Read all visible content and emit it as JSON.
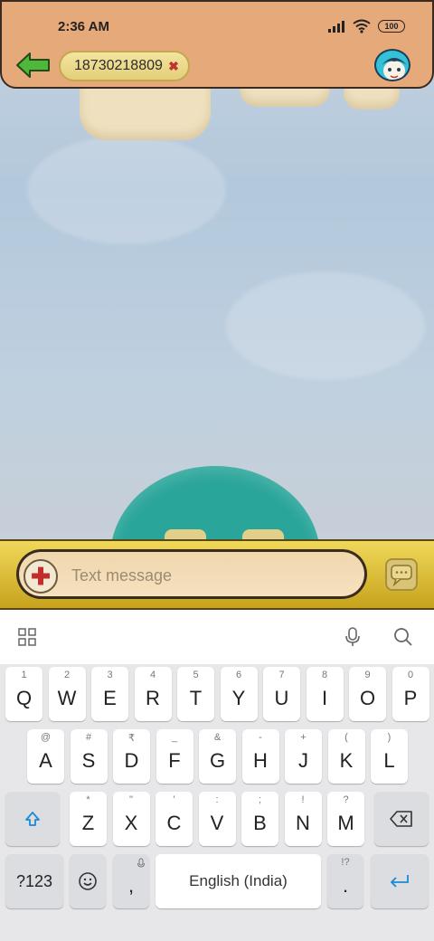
{
  "status_bar": {
    "time": "2:36 AM",
    "battery": "100"
  },
  "header": {
    "recipient": "18730218809"
  },
  "compose": {
    "placeholder": "Text message"
  },
  "keyboard": {
    "row1": [
      {
        "hint": "1",
        "label": "Q"
      },
      {
        "hint": "2",
        "label": "W"
      },
      {
        "hint": "3",
        "label": "E"
      },
      {
        "hint": "4",
        "label": "R"
      },
      {
        "hint": "5",
        "label": "T"
      },
      {
        "hint": "6",
        "label": "Y"
      },
      {
        "hint": "7",
        "label": "U"
      },
      {
        "hint": "8",
        "label": "I"
      },
      {
        "hint": "9",
        "label": "O"
      },
      {
        "hint": "0",
        "label": "P"
      }
    ],
    "row2": [
      {
        "hint": "@",
        "label": "A"
      },
      {
        "hint": "#",
        "label": "S"
      },
      {
        "hint": "₹",
        "label": "D"
      },
      {
        "hint": "_",
        "label": "F"
      },
      {
        "hint": "&",
        "label": "G"
      },
      {
        "hint": "-",
        "label": "H"
      },
      {
        "hint": "+",
        "label": "J"
      },
      {
        "hint": "(",
        "label": "K"
      },
      {
        "hint": ")",
        "label": "L"
      }
    ],
    "row3": [
      {
        "hint": "*",
        "label": "Z"
      },
      {
        "hint": "\"",
        "label": "X"
      },
      {
        "hint": "'",
        "label": "C"
      },
      {
        "hint": ":",
        "label": "V"
      },
      {
        "hint": ";",
        "label": "B"
      },
      {
        "hint": "!",
        "label": "N"
      },
      {
        "hint": "?",
        "label": "M"
      }
    ],
    "symbols_label": "?123",
    "comma_label": ",",
    "space_label": "English (India)",
    "period_hint": "!?",
    "period_label": "."
  },
  "colors": {
    "header_bg": "#e6a97a",
    "compose_gold": "#e3c43c",
    "accent_blue": "#1a8ad6"
  }
}
